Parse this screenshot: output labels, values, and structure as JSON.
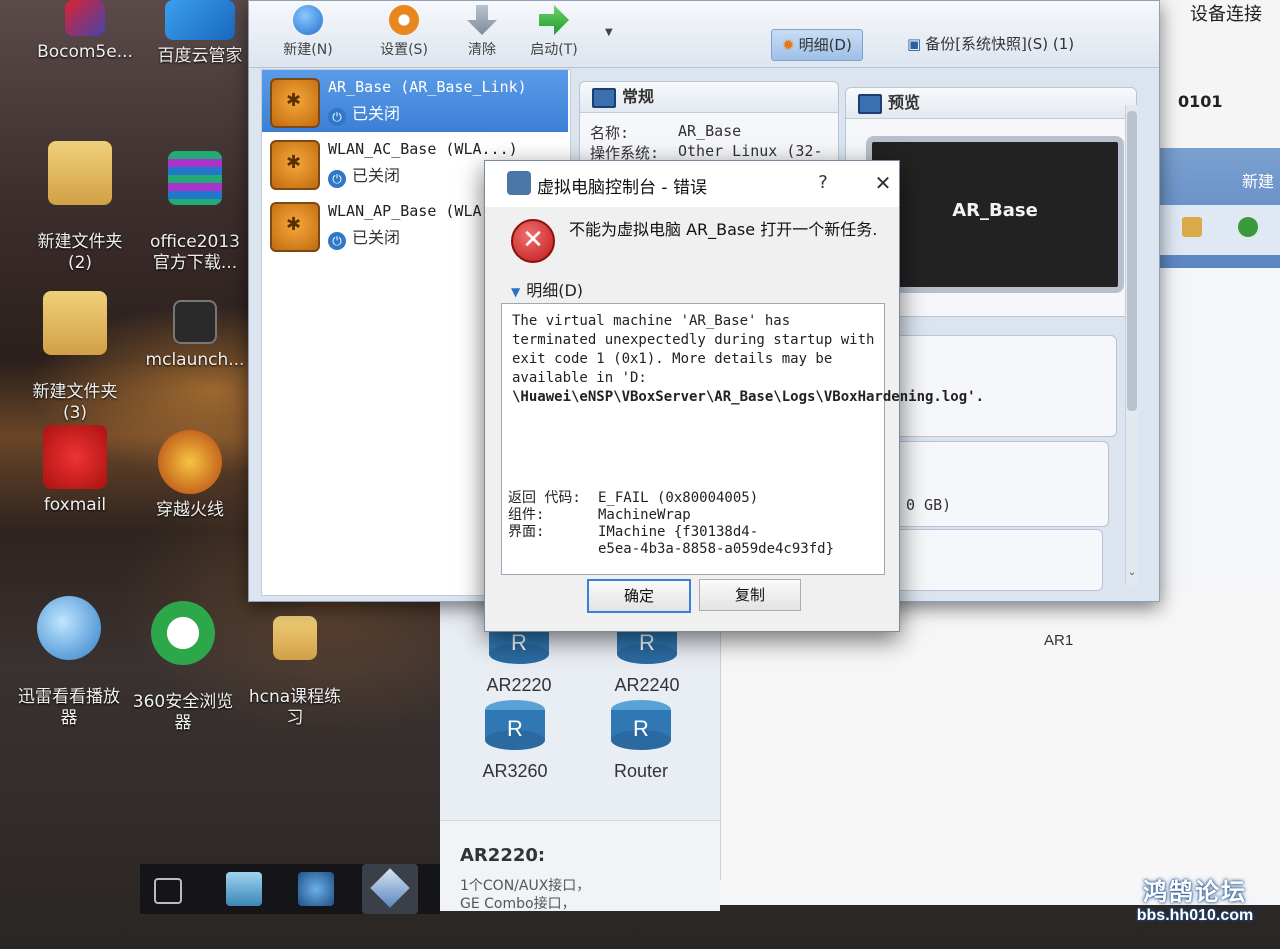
{
  "desktop": {
    "icons": [
      {
        "label": "Bocom5e..."
      },
      {
        "label": "百度云管家"
      },
      {
        "label": "新建文件夹\n(2)"
      },
      {
        "label": "office2013\n官方下载..."
      },
      {
        "label": "新建文件夹\n(3)"
      },
      {
        "label": "mclaunch..."
      },
      {
        "label": "foxmail"
      },
      {
        "label": "穿越火线"
      },
      {
        "label": "迅雷看看播放\n器"
      },
      {
        "label": "360安全浏览\n器"
      },
      {
        "label": "hcna课程练\n习"
      }
    ]
  },
  "vbox": {
    "toolbar": {
      "new": "新建(N)",
      "settings": "设置(S)",
      "discard": "清除",
      "start": "启动(T)",
      "details_tab": "明细(D)",
      "snapshots_tab": "备份[系统快照](S) (1)"
    },
    "vms": [
      {
        "name": "AR_Base (AR_Base_Link)",
        "state": "已关闭",
        "selected": true
      },
      {
        "name": "WLAN_AC_Base (WLA...)",
        "state": "已关闭",
        "selected": false
      },
      {
        "name": "WLAN_AP_Base (WLA...",
        "state": "已关闭",
        "selected": false
      }
    ],
    "general": {
      "title": "常规",
      "name_label": "名称:",
      "name_value": "AR_Base",
      "os_label": "操作系统:",
      "os_value": "Other Linux (32-"
    },
    "preview": {
      "title": "预览",
      "screen_text": "AR_Base"
    },
    "storage_fragment": "0 GB)"
  },
  "dialog": {
    "title": "虚拟电脑控制台 - 错误",
    "help": "?",
    "close": "✕",
    "message": "不能为虚拟电脑 AR_Base 打开一个新任务.",
    "details_toggle": "明细(D)",
    "details_text": "The virtual machine 'AR_Base' has terminated unexpectedly during startup with exit code 1 (0x1). More details may be available in 'D:",
    "details_path": "\\Huawei\\eNSP\\VBoxServer\\AR_Base\\Logs\\VBoxHardening.log'.",
    "codes": [
      {
        "key": "返回 代码:",
        "value": "E_FAIL (0x80004005)"
      },
      {
        "key": "组件:",
        "value": "MachineWrap"
      },
      {
        "key": "界面:",
        "value": "IMachine {f30138d4-"
      },
      {
        "key": "",
        "value": "e5ea-4b3a-8858-a059de4c93fd}"
      }
    ],
    "ok": "确定",
    "copy": "复制"
  },
  "ensp": {
    "devices": [
      "AR2220",
      "AR2240",
      "AR3260",
      "Router"
    ],
    "detail_title": "AR2220:",
    "detail_line1": "1个CON/AUX接口，",
    "detail_line2": "GE Combo接口，",
    "canvas_label": "AR1",
    "right_fragment": "0101",
    "right_band_label": "新建",
    "right_top_label": "设备连接"
  },
  "watermark": {
    "title": "鸿鹄论坛",
    "url": "bbs.hh010.com"
  },
  "colors": {
    "selection": "#3c7fd6",
    "error_red": "#c01818",
    "link_blue": "#2a72c4"
  }
}
